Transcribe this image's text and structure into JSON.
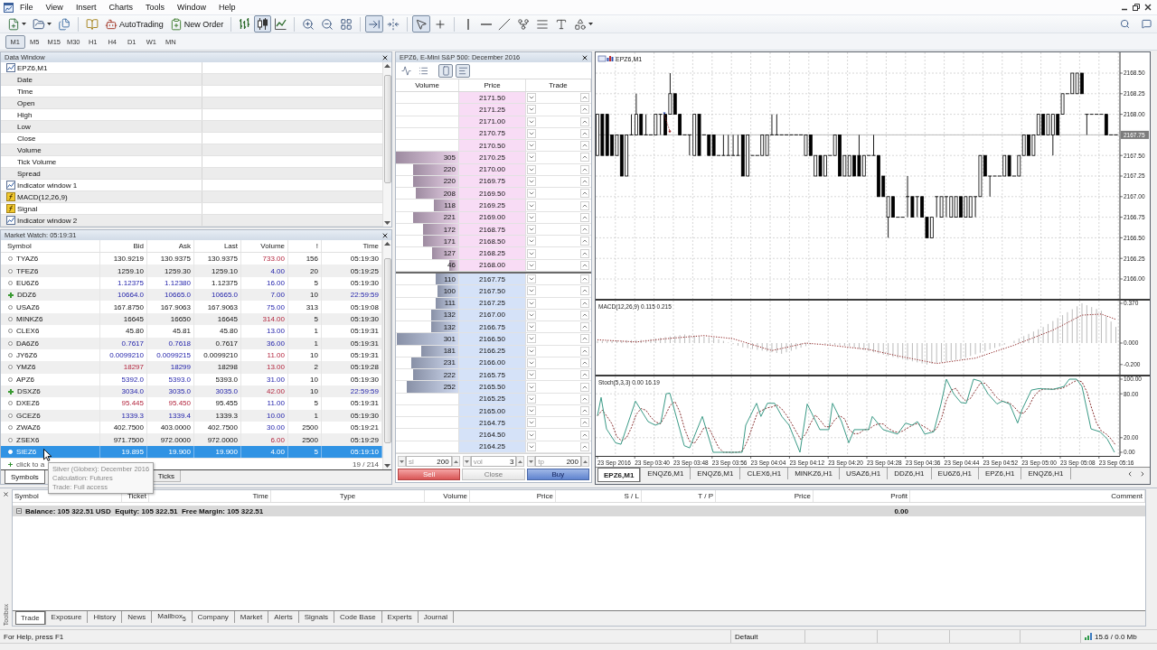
{
  "menu_bar": {
    "items": [
      "File",
      "View",
      "Insert",
      "Charts",
      "Tools",
      "Window",
      "Help"
    ]
  },
  "toolbar": {
    "autotrading": "AutoTrading",
    "new_order": "New Order",
    "chart_types": [
      {
        "selected": false
      },
      {
        "selected": true
      },
      {
        "selected": false
      }
    ],
    "scroll_modes": [
      {
        "selected": true
      },
      {
        "selected": false
      }
    ],
    "cursor_modes": [
      {
        "selected": true
      },
      {
        "selected": false
      }
    ]
  },
  "timeframes": [
    {
      "label": "M1",
      "selected": true
    },
    {
      "label": "M5",
      "selected": false
    },
    {
      "label": "M15",
      "selected": false
    },
    {
      "label": "M30",
      "selected": false
    },
    {
      "label": "H1",
      "selected": false
    },
    {
      "label": "H4",
      "selected": false
    },
    {
      "label": "D1",
      "selected": false
    },
    {
      "label": "W1",
      "selected": false
    },
    {
      "label": "MN",
      "selected": false
    }
  ],
  "data_window": {
    "title": "Data Window",
    "rows": [
      {
        "label": "EPZ6,M1",
        "kind": "chart"
      },
      {
        "label": "Date",
        "kind": "field"
      },
      {
        "label": "Time",
        "kind": "field"
      },
      {
        "label": "Open",
        "kind": "field"
      },
      {
        "label": "High",
        "kind": "field"
      },
      {
        "label": "Low",
        "kind": "field"
      },
      {
        "label": "Close",
        "kind": "field"
      },
      {
        "label": "Volume",
        "kind": "field"
      },
      {
        "label": "Tick Volume",
        "kind": "field"
      },
      {
        "label": "Spread",
        "kind": "field"
      },
      {
        "label": "Indicator window 1",
        "kind": "chart"
      },
      {
        "label": "MACD(12,26,9)",
        "kind": "indicator"
      },
      {
        "label": "Signal",
        "kind": "indicator"
      },
      {
        "label": "Indicator window 2",
        "kind": "chart"
      }
    ]
  },
  "market_watch": {
    "title": "Market Watch: 05:19:31",
    "columns": [
      "Symbol",
      "Bid",
      "Ask",
      "Last",
      "Volume",
      "!",
      "Time"
    ],
    "rows": [
      {
        "kind": "normal",
        "selected": false,
        "cells": [
          {
            "text": "TYAZ6"
          },
          {
            "text": "130.9219",
            "up": false,
            "down": false
          },
          {
            "text": "130.9375",
            "up": false,
            "down": false
          },
          {
            "text": "130.9375",
            "up": false,
            "down": false
          },
          {
            "text": "733.00",
            "up": false,
            "down": true
          },
          {
            "text": "156",
            "up": false,
            "down": false
          },
          {
            "text": "05:19:30",
            "up": false,
            "down": false
          }
        ]
      },
      {
        "kind": "normal",
        "selected": false,
        "cells": [
          {
            "text": "TFEZ6"
          },
          {
            "text": "1259.10",
            "up": false,
            "down": false
          },
          {
            "text": "1259.30",
            "up": false,
            "down": false
          },
          {
            "text": "1259.10",
            "up": false,
            "down": false
          },
          {
            "text": "4.00",
            "up": true,
            "down": false
          },
          {
            "text": "20",
            "up": false,
            "down": false
          },
          {
            "text": "05:19:25",
            "up": false,
            "down": false
          }
        ]
      },
      {
        "kind": "normal",
        "selected": false,
        "cells": [
          {
            "text": "EU6Z6"
          },
          {
            "text": "1.12375",
            "up": true,
            "down": false
          },
          {
            "text": "1.12380",
            "up": true,
            "down": false
          },
          {
            "text": "1.12375",
            "up": false,
            "down": false
          },
          {
            "text": "16.00",
            "up": true,
            "down": false
          },
          {
            "text": "5",
            "up": false,
            "down": false
          },
          {
            "text": "05:19:30",
            "up": false,
            "down": false
          }
        ]
      },
      {
        "kind": "flagged",
        "selected": false,
        "cells": [
          {
            "text": "DDZ6"
          },
          {
            "text": "10664.0",
            "up": true,
            "down": false
          },
          {
            "text": "10665.0",
            "up": true,
            "down": false
          },
          {
            "text": "10665.0",
            "up": true,
            "down": false
          },
          {
            "text": "7.00",
            "up": true,
            "down": false
          },
          {
            "text": "10",
            "up": false,
            "down": false
          },
          {
            "text": "22:59:59",
            "up": true,
            "down": false
          }
        ]
      },
      {
        "kind": "normal",
        "selected": false,
        "cells": [
          {
            "text": "USAZ6"
          },
          {
            "text": "167.8750",
            "up": false,
            "down": false
          },
          {
            "text": "167.9063",
            "up": false,
            "down": false
          },
          {
            "text": "167.9063",
            "up": false,
            "down": false
          },
          {
            "text": "75.00",
            "up": true,
            "down": false
          },
          {
            "text": "313",
            "up": false,
            "down": false
          },
          {
            "text": "05:19:08",
            "up": false,
            "down": false
          }
        ]
      },
      {
        "kind": "normal",
        "selected": false,
        "cells": [
          {
            "text": "MINKZ6"
          },
          {
            "text": "16645",
            "up": false,
            "down": false
          },
          {
            "text": "16650",
            "up": false,
            "down": false
          },
          {
            "text": "16645",
            "up": false,
            "down": false
          },
          {
            "text": "314.00",
            "up": false,
            "down": true
          },
          {
            "text": "5",
            "up": false,
            "down": false
          },
          {
            "text": "05:19:30",
            "up": false,
            "down": false
          }
        ]
      },
      {
        "kind": "normal",
        "selected": false,
        "cells": [
          {
            "text": "CLEX6"
          },
          {
            "text": "45.80",
            "up": false,
            "down": false
          },
          {
            "text": "45.81",
            "up": false,
            "down": false
          },
          {
            "text": "45.80",
            "up": false,
            "down": false
          },
          {
            "text": "13.00",
            "up": true,
            "down": false
          },
          {
            "text": "1",
            "up": false,
            "down": false
          },
          {
            "text": "05:19:31",
            "up": false,
            "down": false
          }
        ]
      },
      {
        "kind": "normal",
        "selected": false,
        "cells": [
          {
            "text": "DA6Z6"
          },
          {
            "text": "0.7617",
            "up": true,
            "down": false
          },
          {
            "text": "0.7618",
            "up": true,
            "down": false
          },
          {
            "text": "0.7617",
            "up": false,
            "down": false
          },
          {
            "text": "36.00",
            "up": true,
            "down": false
          },
          {
            "text": "1",
            "up": false,
            "down": false
          },
          {
            "text": "05:19:31",
            "up": false,
            "down": false
          }
        ]
      },
      {
        "kind": "normal",
        "selected": false,
        "cells": [
          {
            "text": "JY6Z6"
          },
          {
            "text": "0.0099210",
            "up": true,
            "down": false
          },
          {
            "text": "0.0099215",
            "up": true,
            "down": false
          },
          {
            "text": "0.0099210",
            "up": false,
            "down": false
          },
          {
            "text": "11.00",
            "up": false,
            "down": true
          },
          {
            "text": "10",
            "up": false,
            "down": false
          },
          {
            "text": "05:19:31",
            "up": false,
            "down": false
          }
        ]
      },
      {
        "kind": "normal",
        "selected": false,
        "cells": [
          {
            "text": "YMZ6"
          },
          {
            "text": "18297",
            "up": false,
            "down": true
          },
          {
            "text": "18299",
            "up": true,
            "down": false
          },
          {
            "text": "18298",
            "up": false,
            "down": false
          },
          {
            "text": "13.00",
            "up": false,
            "down": true
          },
          {
            "text": "2",
            "up": false,
            "down": false
          },
          {
            "text": "05:19:28",
            "up": false,
            "down": false
          }
        ]
      },
      {
        "kind": "normal",
        "selected": false,
        "cells": [
          {
            "text": "APZ6"
          },
          {
            "text": "5392.0",
            "up": true,
            "down": false
          },
          {
            "text": "5393.0",
            "up": true,
            "down": false
          },
          {
            "text": "5393.0",
            "up": false,
            "down": false
          },
          {
            "text": "31.00",
            "up": true,
            "down": false
          },
          {
            "text": "10",
            "up": false,
            "down": false
          },
          {
            "text": "05:19:30",
            "up": false,
            "down": false
          }
        ]
      },
      {
        "kind": "flagged",
        "selected": false,
        "cells": [
          {
            "text": "DSXZ6"
          },
          {
            "text": "3034.0",
            "up": true,
            "down": false
          },
          {
            "text": "3035.0",
            "up": true,
            "down": false
          },
          {
            "text": "3035.0",
            "up": true,
            "down": false
          },
          {
            "text": "42.00",
            "up": false,
            "down": true
          },
          {
            "text": "10",
            "up": false,
            "down": false
          },
          {
            "text": "22:59:59",
            "up": true,
            "down": false
          }
        ]
      },
      {
        "kind": "normal",
        "selected": false,
        "cells": [
          {
            "text": "DXEZ6"
          },
          {
            "text": "95.445",
            "up": false,
            "down": true
          },
          {
            "text": "95.450",
            "up": false,
            "down": true
          },
          {
            "text": "95.455",
            "up": false,
            "down": false
          },
          {
            "text": "11.00",
            "up": true,
            "down": false
          },
          {
            "text": "5",
            "up": false,
            "down": false
          },
          {
            "text": "05:19:31",
            "up": false,
            "down": false
          }
        ]
      },
      {
        "kind": "normal",
        "selected": false,
        "cells": [
          {
            "text": "GCEZ6"
          },
          {
            "text": "1339.3",
            "up": true,
            "down": false
          },
          {
            "text": "1339.4",
            "up": true,
            "down": false
          },
          {
            "text": "1339.3",
            "up": false,
            "down": false
          },
          {
            "text": "10.00",
            "up": true,
            "down": false
          },
          {
            "text": "1",
            "up": false,
            "down": false
          },
          {
            "text": "05:19:30",
            "up": false,
            "down": false
          }
        ]
      },
      {
        "kind": "normal",
        "selected": false,
        "cells": [
          {
            "text": "ZWAZ6"
          },
          {
            "text": "402.7500",
            "up": false,
            "down": false
          },
          {
            "text": "403.0000",
            "up": false,
            "down": false
          },
          {
            "text": "402.7500",
            "up": false,
            "down": false
          },
          {
            "text": "30.00",
            "up": true,
            "down": false
          },
          {
            "text": "2500",
            "up": false,
            "down": false
          },
          {
            "text": "05:19:21",
            "up": false,
            "down": false
          }
        ]
      },
      {
        "kind": "normal",
        "selected": false,
        "cells": [
          {
            "text": "ZSEX6"
          },
          {
            "text": "971.7500",
            "up": false,
            "down": false
          },
          {
            "text": "972.0000",
            "up": false,
            "down": false
          },
          {
            "text": "972.0000",
            "up": false,
            "down": false
          },
          {
            "text": "6.00",
            "up": false,
            "down": true
          },
          {
            "text": "2500",
            "up": false,
            "down": false
          },
          {
            "text": "05:19:29",
            "up": false,
            "down": false
          }
        ]
      },
      {
        "kind": "normal",
        "selected": true,
        "cells": [
          {
            "text": "SIEZ6"
          },
          {
            "text": "19.895",
            "up": false,
            "down": false
          },
          {
            "text": "19.900",
            "up": false,
            "down": false
          },
          {
            "text": "19.900",
            "up": false,
            "down": false
          },
          {
            "text": "4.00",
            "up": false,
            "down": false
          },
          {
            "text": "5",
            "up": false,
            "down": false
          },
          {
            "text": "05:19:10",
            "up": false,
            "down": false
          }
        ]
      }
    ],
    "add_hint": "click to a",
    "count": "19 / 214",
    "tabs": [
      {
        "label": "Symbols",
        "selected": true
      },
      {
        "label": "Ticks",
        "selected": false
      }
    ],
    "tooltip": [
      "Silver (Globex): December 2016",
      "Calculation: Futures",
      "Trade: Full access"
    ]
  },
  "depth_of_market": {
    "title": "EPZ6, E-Mini S&P 500: December 2016",
    "tools": [
      {
        "selected": false
      },
      {
        "selected": false
      },
      {
        "selected": true
      },
      {
        "selected": true
      }
    ],
    "columns": [
      "Volume",
      "Price",
      "Trade"
    ],
    "rows": [
      {
        "kind": "ask",
        "price": "2171.50"
      },
      {
        "kind": "ask",
        "price": "2171.25"
      },
      {
        "kind": "ask",
        "price": "2171.00"
      },
      {
        "kind": "ask",
        "price": "2170.75"
      },
      {
        "kind": "ask",
        "price": "2170.50"
      },
      {
        "kind": "ask",
        "price": "2170.25",
        "volume": "305",
        "level": 1
      },
      {
        "kind": "ask",
        "price": "2170.00",
        "volume": "220",
        "level": 0.72
      },
      {
        "kind": "ask",
        "price": "2169.75",
        "volume": "220",
        "level": 0.72
      },
      {
        "kind": "ask",
        "price": "2169.50",
        "volume": "208",
        "level": 0.68
      },
      {
        "kind": "ask",
        "price": "2169.25",
        "volume": "118",
        "level": 0.39
      },
      {
        "kind": "ask",
        "price": "2169.00",
        "volume": "221",
        "level": 0.72
      },
      {
        "kind": "ask",
        "price": "2168.75",
        "volume": "172",
        "level": 0.56
      },
      {
        "kind": "ask",
        "price": "2168.50",
        "volume": "171",
        "level": 0.56
      },
      {
        "kind": "ask",
        "price": "2168.25",
        "volume": "127",
        "level": 0.42
      },
      {
        "kind": "ask",
        "price": "2168.00",
        "volume": "46",
        "level": 0.15
      },
      {
        "kind": "bid",
        "price": "2167.75",
        "volume": "110",
        "level": 0.36
      },
      {
        "kind": "bid",
        "price": "2167.50",
        "volume": "100",
        "level": 0.33
      },
      {
        "kind": "bid",
        "price": "2167.25",
        "volume": "111",
        "level": 0.36
      },
      {
        "kind": "bid",
        "price": "2167.00",
        "volume": "132",
        "level": 0.43
      },
      {
        "kind": "bid",
        "price": "2166.75",
        "volume": "132",
        "level": 0.43
      },
      {
        "kind": "bid",
        "price": "2166.50",
        "volume": "301",
        "level": 0.99
      },
      {
        "kind": "bid",
        "price": "2166.25",
        "volume": "181",
        "level": 0.59
      },
      {
        "kind": "bid",
        "price": "2166.00",
        "volume": "231",
        "level": 0.76
      },
      {
        "kind": "bid",
        "price": "2165.75",
        "volume": "222",
        "level": 0.73
      },
      {
        "kind": "bid",
        "price": "2165.50",
        "volume": "252",
        "level": 0.83
      },
      {
        "kind": "bid",
        "price": "2165.25"
      },
      {
        "kind": "bid",
        "price": "2165.00"
      },
      {
        "kind": "bid",
        "price": "2164.75"
      },
      {
        "kind": "bid",
        "price": "2164.50"
      },
      {
        "kind": "bid",
        "price": "2164.25"
      }
    ],
    "fields": [
      {
        "label": "sl",
        "value": "200"
      },
      {
        "label": "vol",
        "value": "3"
      },
      {
        "label": "tp",
        "value": "200"
      }
    ],
    "buttons": [
      {
        "label": "Sell",
        "kind": "sell"
      },
      {
        "label": "Close",
        "kind": "close"
      },
      {
        "label": "Buy",
        "kind": "buy"
      }
    ]
  },
  "chart": {
    "title": "EPZ6,M1",
    "price_scale": [
      {
        "text": "2168.50",
        "kind": "tick"
      },
      {
        "text": "2168.25",
        "kind": "tick"
      },
      {
        "text": "2168.00",
        "kind": "tick"
      },
      {
        "text": "2167.75",
        "kind": "current"
      },
      {
        "text": "2167.50",
        "kind": "tick"
      },
      {
        "text": "2167.25",
        "kind": "tick"
      },
      {
        "text": "2167.00",
        "kind": "tick"
      },
      {
        "text": "2166.75",
        "kind": "tick"
      },
      {
        "text": "2166.50",
        "kind": "tick"
      },
      {
        "text": "2166.25",
        "kind": "tick"
      },
      {
        "text": "2166.00",
        "kind": "tick"
      }
    ],
    "macd": {
      "label": "MACD(12,26,9) 0.115 0.215",
      "scale": [
        "0.370",
        "0.000",
        "-0.200"
      ]
    },
    "stochastic": {
      "label": "Stoch(5,3,3) 0.00 16.19",
      "scale": [
        "100.00",
        "80.00",
        "20.00",
        "0.00"
      ]
    },
    "time_scale": [
      "23 Sep 2016",
      "23 Sep 03:40",
      "23 Sep 03:48",
      "23 Sep 03:56",
      "23 Sep 04:04",
      "23 Sep 04:12",
      "23 Sep 04:20",
      "23 Sep 04:28",
      "23 Sep 04:36",
      "23 Sep 04:44",
      "23 Sep 04:52",
      "23 Sep 05:00",
      "23 Sep 05:08",
      "23 Sep 05:16"
    ],
    "tabs": [
      {
        "label": "EPZ6,M1",
        "selected": true
      },
      {
        "label": "ENQZ6,M1",
        "selected": false
      },
      {
        "label": "ENQZ6,M1",
        "selected": false
      },
      {
        "label": "CLEX6,H1",
        "selected": false
      },
      {
        "label": "MINKZ6,H1",
        "selected": false
      },
      {
        "label": "USAZ6,H1",
        "selected": false
      },
      {
        "label": "DDZ6,H1",
        "selected": false
      },
      {
        "label": "EU6Z6,H1",
        "selected": false
      },
      {
        "label": "EPZ6,H1",
        "selected": false
      },
      {
        "label": "ENQZ6,H1",
        "selected": false
      }
    ]
  },
  "toolbox": {
    "side_label": "Toolbox",
    "columns": [
      "Symbol",
      "Ticket",
      "Time",
      "Type",
      "Volume",
      "Price",
      "S / L",
      "T / P",
      "Price",
      "Profit",
      "Comment"
    ],
    "balance": "Balance: 105 322.51 USD  Equity: 105 322.51  Free Margin: 105 322.51",
    "profit": "0.00",
    "tabs": [
      {
        "label": "Trade",
        "selected": true
      },
      {
        "label": "Exposure",
        "selected": false
      },
      {
        "label": "History",
        "selected": false
      },
      {
        "label": "News",
        "selected": false
      },
      {
        "label": "Mailbox$_{5}$",
        "selected": false
      },
      {
        "label": "Company",
        "selected": false
      },
      {
        "label": "Market",
        "selected": false
      },
      {
        "label": "Alerts",
        "selected": false
      },
      {
        "label": "Signals",
        "selected": false
      },
      {
        "label": "Code Base",
        "selected": false
      },
      {
        "label": "Experts",
        "selected": false
      },
      {
        "label": "Journal",
        "selected": false
      }
    ]
  },
  "status_bar": {
    "help": "For Help, press F1",
    "profile": "Default",
    "memory": "15.6 / 0.0 Mb"
  }
}
